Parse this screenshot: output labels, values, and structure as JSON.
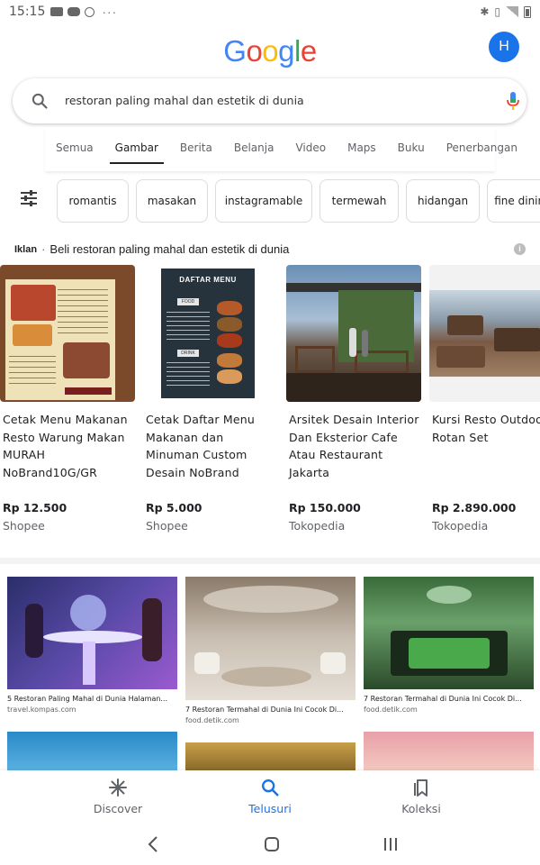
{
  "status_bar": {
    "time": "15:15",
    "more": "···"
  },
  "header": {
    "logo_letters": [
      {
        "ch": "G",
        "color": "#4285F4"
      },
      {
        "ch": "o",
        "color": "#EA4335"
      },
      {
        "ch": "o",
        "color": "#FBBC05"
      },
      {
        "ch": "g",
        "color": "#4285F4"
      },
      {
        "ch": "l",
        "color": "#34A853"
      },
      {
        "ch": "e",
        "color": "#EA4335"
      }
    ],
    "avatar_initial": "H"
  },
  "search": {
    "query": "restoran paling mahal dan estetik di dunia"
  },
  "tabs": [
    {
      "label": "Semua",
      "active": false
    },
    {
      "label": "Gambar",
      "active": true
    },
    {
      "label": "Berita",
      "active": false
    },
    {
      "label": "Belanja",
      "active": false
    },
    {
      "label": "Video",
      "active": false
    },
    {
      "label": "Maps",
      "active": false
    },
    {
      "label": "Buku",
      "active": false
    },
    {
      "label": "Penerbangan",
      "active": false
    }
  ],
  "chips": [
    "romantis",
    "masakan",
    "instagramable",
    "termewah",
    "hidangan",
    "fine dining"
  ],
  "ads": {
    "tag": "Iklan",
    "separator": "·",
    "title": "Beli restoran paling mahal dan estetik di dunia",
    "products": [
      {
        "name": "Cetak Menu Makanan Resto Warung Makan MURAH NoBrand10G/GR",
        "price": "Rp 12.500",
        "store": "Shopee"
      },
      {
        "name": "Cetak Daftar Menu Makanan dan Minuman Custom Desain NoBrand",
        "price": "Rp 5.000",
        "store": "Shopee"
      },
      {
        "name": "Arsitek Desain Interior Dan Eksterior Cafe Atau Restaurant Jakarta",
        "price": "Rp 150.000",
        "store": "Tokopedia"
      },
      {
        "name": "Kursi Resto Outdoor Rotan Set",
        "price": "Rp 2.890.000",
        "store": "Tokopedia"
      }
    ],
    "menu_image_text": {
      "title": "DAFTAR MENU",
      "food": "FOOD",
      "drink": "DRINK"
    }
  },
  "results": [
    {
      "title": "5 Restoran Paling Mahal di Dunia Halaman...",
      "source": "travel.kompas.com"
    },
    {
      "title": "7 Restoran Termahal di Dunia Ini Cocok Di...",
      "source": "food.detik.com"
    },
    {
      "title": "7 Restoran Termahal di Dunia Ini Cocok Di...",
      "source": "food.detik.com"
    }
  ],
  "bottom_nav": [
    {
      "label": "Discover",
      "icon": "asterisk-icon",
      "active": false
    },
    {
      "label": "Telusuri",
      "icon": "search-icon",
      "active": true
    },
    {
      "label": "Koleksi",
      "icon": "bookmarks-icon",
      "active": false
    }
  ],
  "colors": {
    "accent": "#1a73e8",
    "text": "#202124",
    "muted": "#5f6368"
  }
}
